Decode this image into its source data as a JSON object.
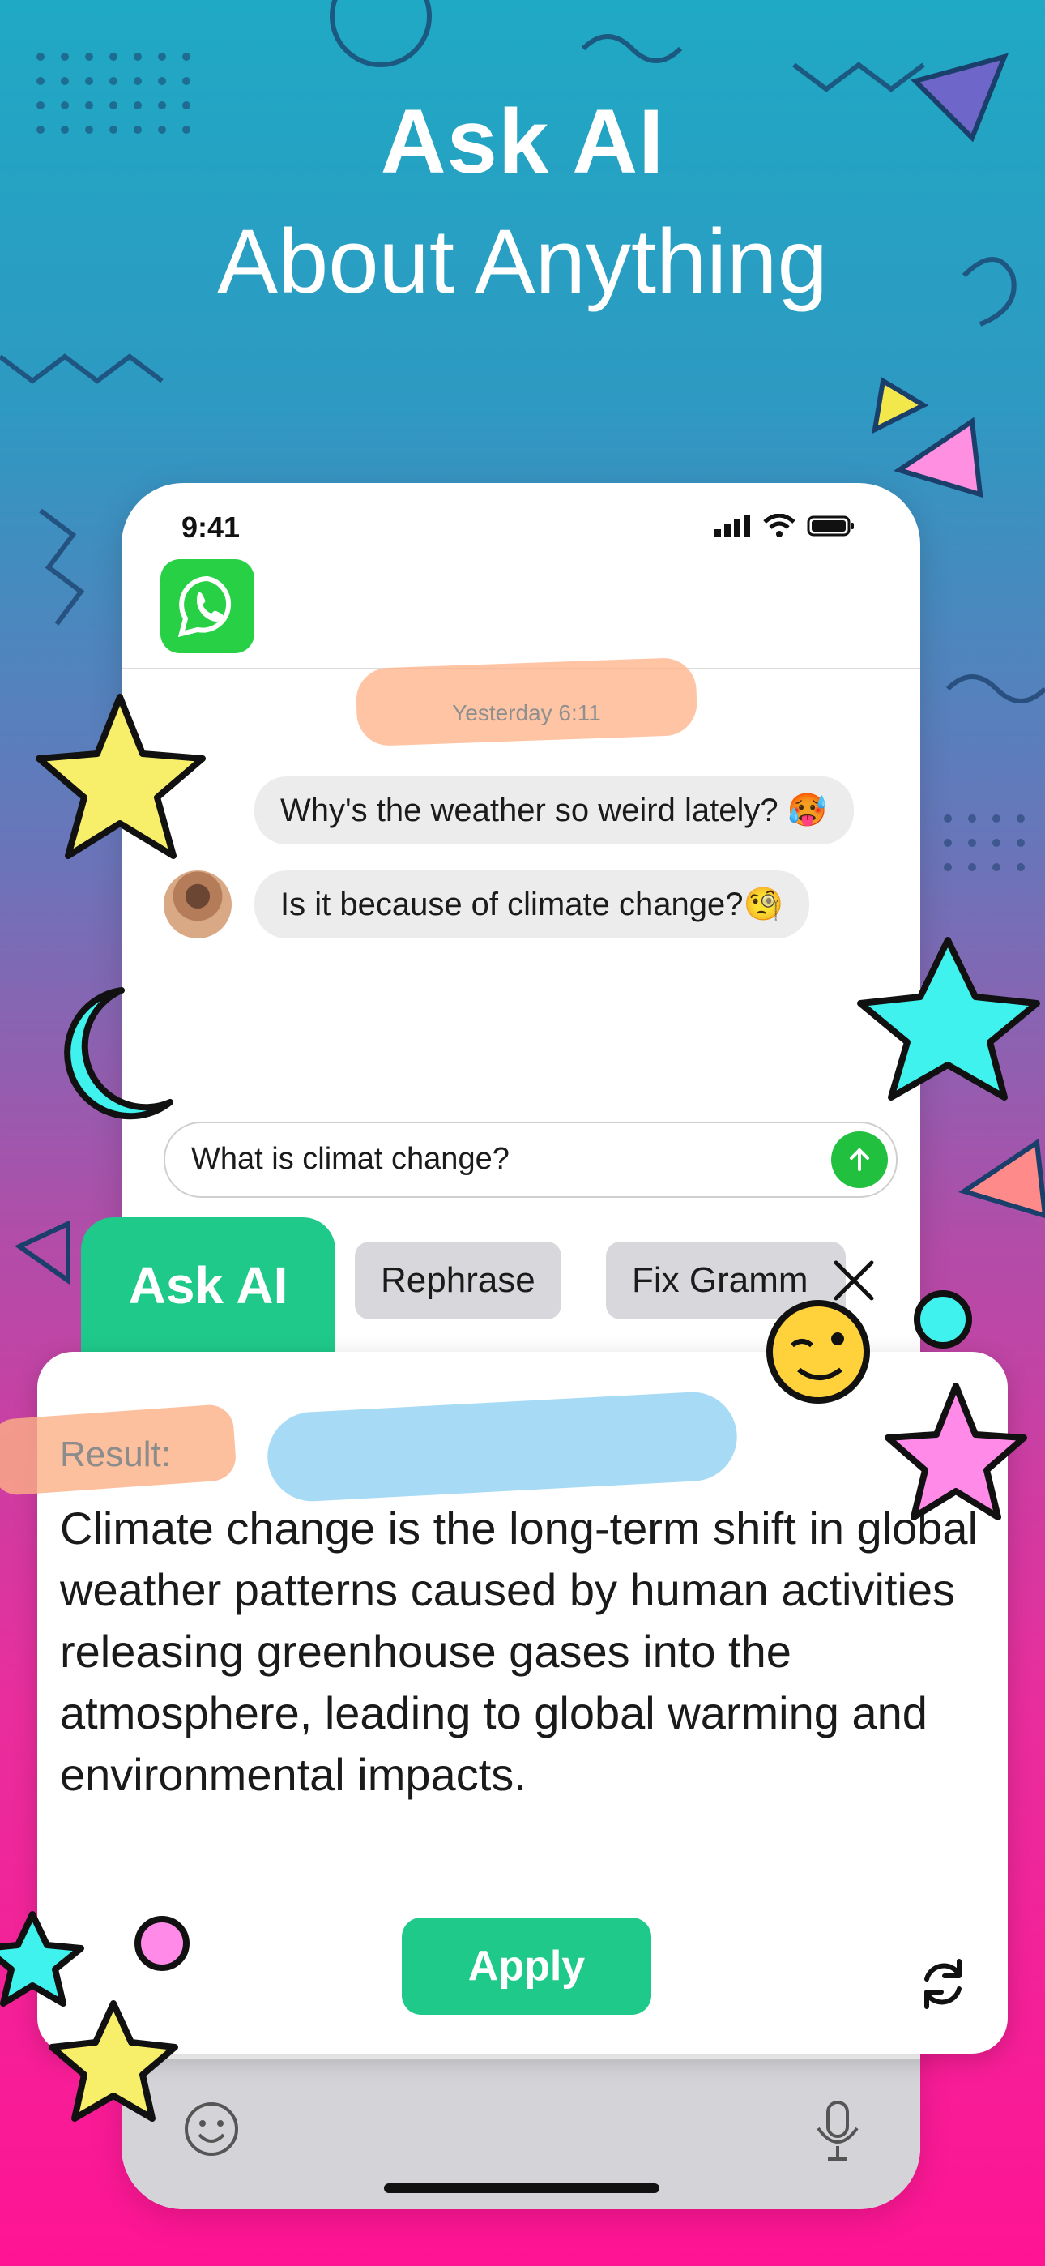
{
  "hero": {
    "title": "Ask AI",
    "subtitle": "About Anything"
  },
  "status_bar": {
    "time": "9:41"
  },
  "chat": {
    "timestamp": "Yesterday 6:11",
    "messages": [
      {
        "text": "Why's the weather so weird lately? 🥵"
      },
      {
        "text": "Is it because of climate change?🧐"
      }
    ]
  },
  "composer": {
    "value": "What is climat change?"
  },
  "ai_tabs": [
    {
      "label": "Ask AI"
    },
    {
      "label": "Rephrase"
    },
    {
      "label": "Fix Gramm"
    }
  ],
  "result": {
    "label": "Result:",
    "text": "Climate change is the long-term shift in global weather patterns caused by human activities releasing greenhouse gases into the atmosphere, leading to global warming and environmental impacts.",
    "apply_label": "Apply"
  },
  "colors": {
    "accent_green": "#1fc98a",
    "whatsapp_green": "#27d045"
  }
}
